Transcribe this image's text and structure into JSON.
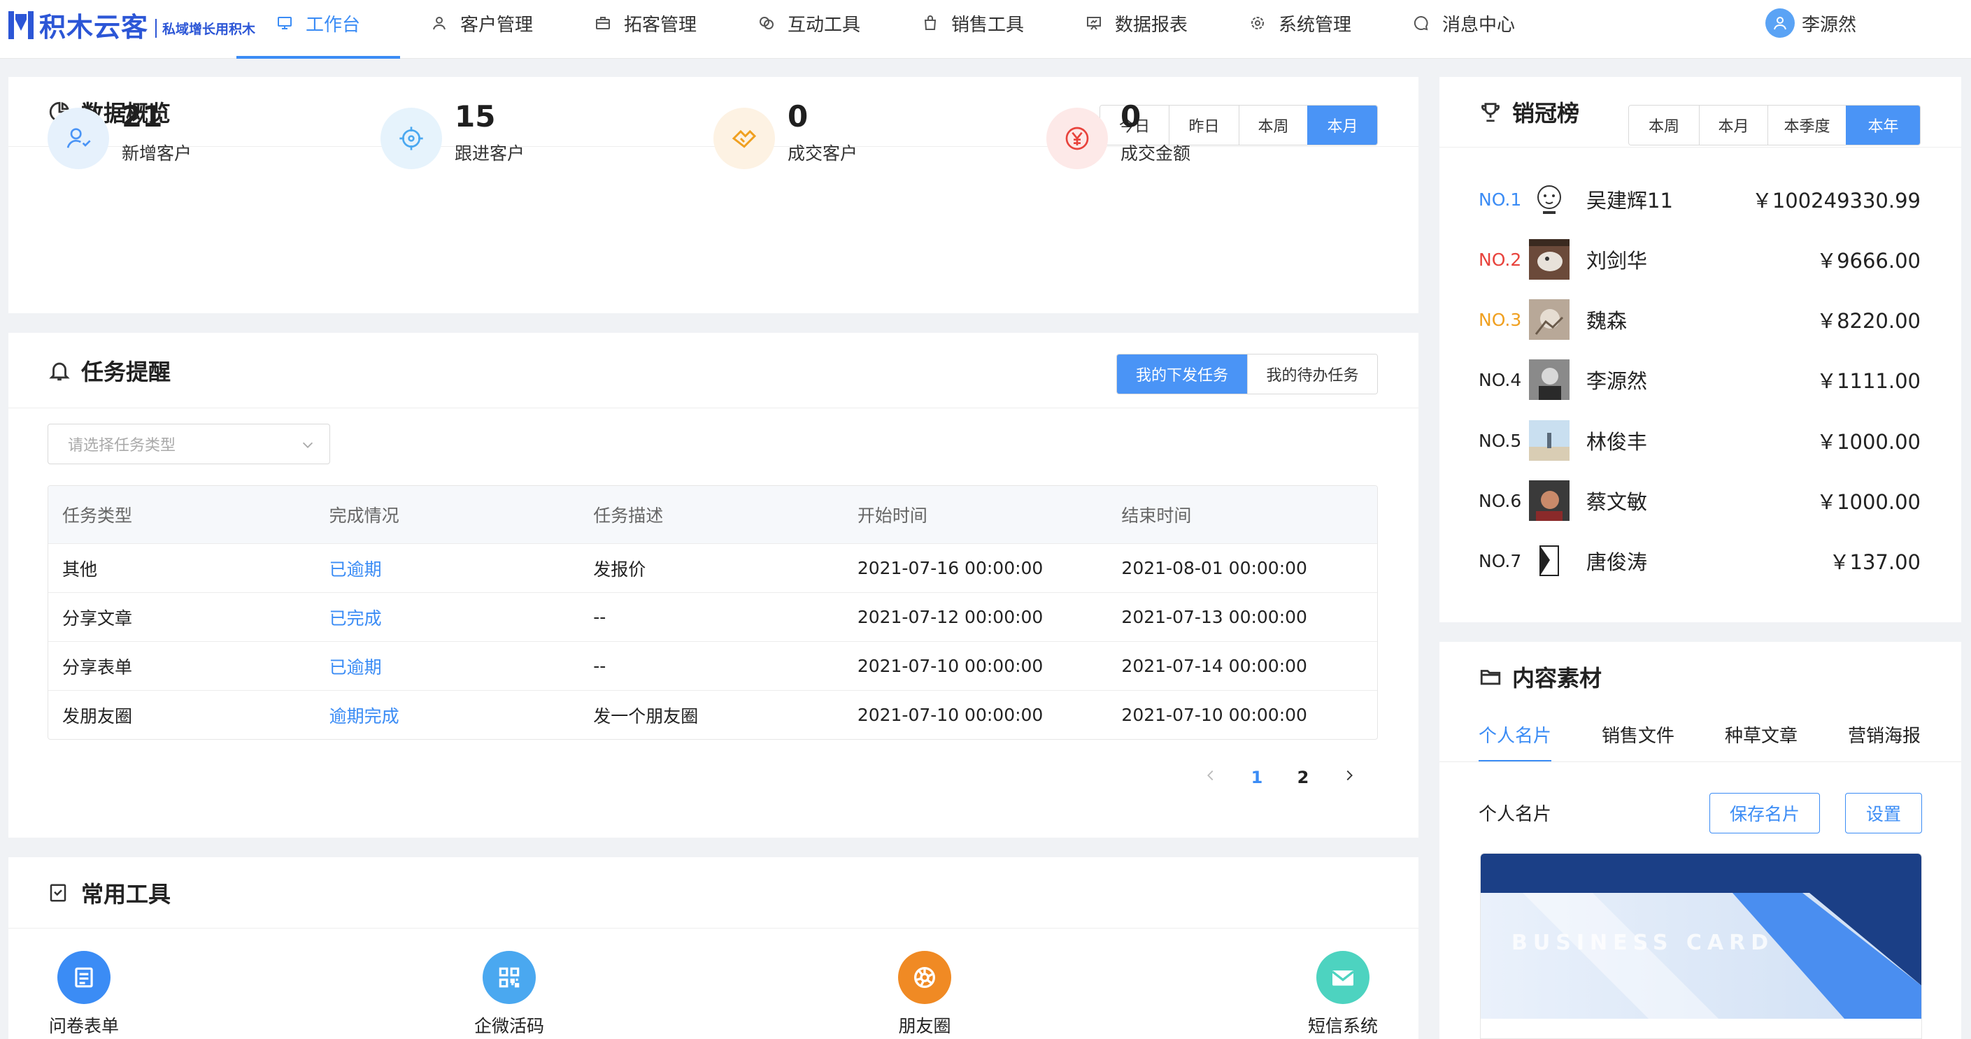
{
  "brand": {
    "name": "积木云客",
    "slogan": "私域增长用积木"
  },
  "nav": [
    {
      "label": "工作台",
      "icon": "monitor-icon",
      "active": true
    },
    {
      "label": "客户管理",
      "icon": "user-icon"
    },
    {
      "label": "拓客管理",
      "icon": "briefcase-icon"
    },
    {
      "label": "互动工具",
      "icon": "chat-link-icon"
    },
    {
      "label": "销售工具",
      "icon": "bag-icon"
    },
    {
      "label": "数据报表",
      "icon": "presentation-icon"
    },
    {
      "label": "系统管理",
      "icon": "gear-icon"
    },
    {
      "label": "消息中心",
      "icon": "message-icon"
    }
  ],
  "user": {
    "name": "李源然"
  },
  "overview": {
    "title": "数据概览",
    "ranges": [
      "今日",
      "昨日",
      "本周",
      "本月"
    ],
    "active_range": "本月",
    "stats": [
      {
        "value": "21",
        "label": "新增客户",
        "icon": "new-customer-icon"
      },
      {
        "value": "15",
        "label": "跟进客户",
        "icon": "target-icon"
      },
      {
        "value": "0",
        "label": "成交客户",
        "icon": "handshake-icon"
      },
      {
        "value": "0",
        "label": "成交金额",
        "icon": "yuan-icon"
      }
    ]
  },
  "tasks": {
    "title": "任务提醒",
    "switch": [
      "我的下发任务",
      "我的待办任务"
    ],
    "select_placeholder": "请选择任务类型",
    "columns": [
      "任务类型",
      "完成情况",
      "任务描述",
      "开始时间",
      "结束时间"
    ],
    "rows": [
      [
        "其他",
        "已逾期",
        "发报价",
        "2021-07-16 00:00:00",
        "2021-08-01 00:00:00"
      ],
      [
        "分享文章",
        "已完成",
        "--",
        "2021-07-12 00:00:00",
        "2021-07-13 00:00:00"
      ],
      [
        "分享表单",
        "已逾期",
        "--",
        "2021-07-10 00:00:00",
        "2021-07-14 00:00:00"
      ],
      [
        "发朋友圈",
        "逾期完成",
        "发一个朋友圈",
        "2021-07-10 00:00:00",
        "2021-07-10 00:00:00"
      ]
    ],
    "pages": [
      "1",
      "2"
    ],
    "current_page": "1"
  },
  "tools": {
    "title": "常用工具",
    "items": [
      {
        "label": "问卷表单",
        "icon": "form-icon",
        "color": "#3b8cf5"
      },
      {
        "label": "企微活码",
        "icon": "qrcode-icon",
        "color": "#4aa8f0"
      },
      {
        "label": "朋友圈",
        "icon": "aperture-icon",
        "color": "#f08a24"
      },
      {
        "label": "短信系统",
        "icon": "mail-icon",
        "color": "#4dd3c0"
      }
    ]
  },
  "ranking": {
    "title": "销冠榜",
    "ranges": [
      "本周",
      "本月",
      "本季度",
      "本年"
    ],
    "active_range": "本年",
    "rows": [
      {
        "no": "NO.1",
        "name": "吴建辉11",
        "amount": "￥100249330.99",
        "color": "#3b8cf5"
      },
      {
        "no": "NO.2",
        "name": "刘剑华",
        "amount": "￥9666.00",
        "color": "#e8433c"
      },
      {
        "no": "NO.3",
        "name": "魏森",
        "amount": "￥8220.00",
        "color": "#f0a020"
      },
      {
        "no": "NO.4",
        "name": "李源然",
        "amount": "￥1111.00",
        "color": "#222222"
      },
      {
        "no": "NO.5",
        "name": "林俊丰",
        "amount": "￥1000.00",
        "color": "#222222"
      },
      {
        "no": "NO.6",
        "name": "蔡文敏",
        "amount": "￥1000.00",
        "color": "#222222"
      },
      {
        "no": "NO.7",
        "name": "唐俊涛",
        "amount": "￥137.00",
        "color": "#222222"
      }
    ]
  },
  "material": {
    "title": "内容素材",
    "tabs": [
      "个人名片",
      "销售文件",
      "种草文章",
      "营销海报"
    ],
    "active_tab": "个人名片",
    "section_label": "个人名片",
    "save_label": "保存名片",
    "settings_label": "设置",
    "card_text": "BUSINESS CARD"
  },
  "colors": {
    "accent": "#3b8cf5",
    "brand": "#2c56d6"
  }
}
